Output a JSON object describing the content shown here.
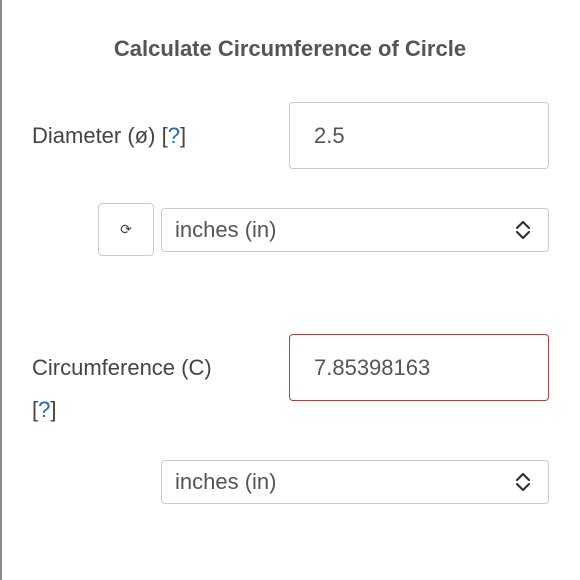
{
  "title": "Calculate Circumference of Circle",
  "diameter": {
    "label": "Diameter (ø)",
    "help": "?",
    "value": "2.5",
    "unit": "inches (in)",
    "swap_glyph": "⟳"
  },
  "circumference": {
    "label": "Circumference (C)",
    "help": "?",
    "value": "7.85398163",
    "unit": "inches (in)"
  },
  "icons": {
    "swap": "refresh-icon",
    "select_chevrons": "up-down-chevron-icon"
  },
  "colors": {
    "help_link": "#1f6aa5",
    "error_border": "#a94442"
  }
}
